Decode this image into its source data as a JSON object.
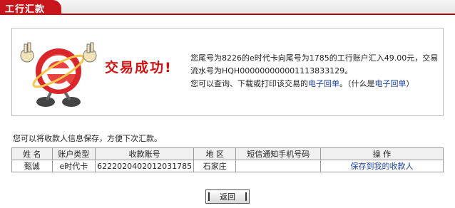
{
  "header": {
    "title": "工行汇款"
  },
  "result": {
    "title": "交易成功!",
    "line1_pre": "您尾号为8226的e时代卡向尾号为1785的工行账户汇入49.00元，交易流水号为HQH000000000001113833129。",
    "line2_pre": "您可以查询、下载或打印该交易的",
    "receipt_link": "电子回单",
    "line2_mid": "。（什么是",
    "what_receipt_link": "电子回单",
    "line2_end": "）"
  },
  "hint": "您可以将收款人信息保存，方便下次汇款。",
  "table": {
    "headers": [
      "姓  名",
      "账户类型",
      "收款账号",
      "地  区",
      "短信通知手机号码",
      "操    作"
    ],
    "row": {
      "name": "甄诚",
      "account_type": "e时代卡",
      "account_no": "6222020402012031785",
      "region": "石家庄",
      "phone": "",
      "action": "保存到我的收款人"
    }
  },
  "back_button": "返回"
}
